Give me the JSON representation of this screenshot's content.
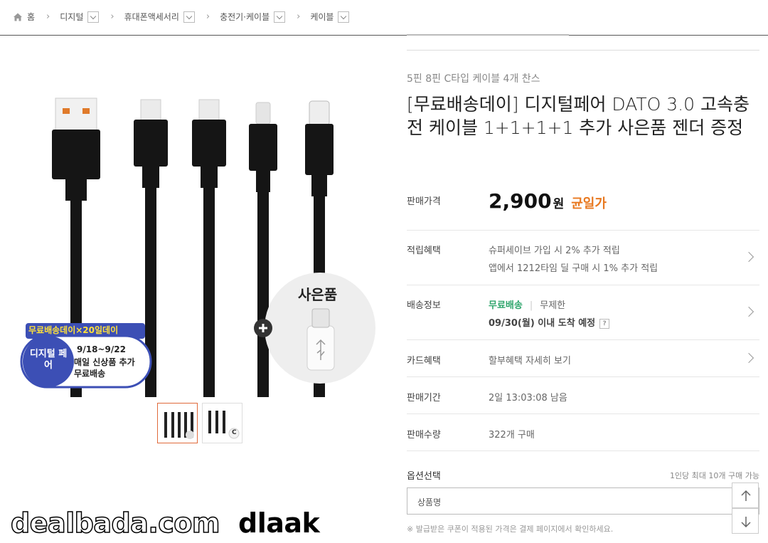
{
  "breadcrumb": {
    "home": "홈",
    "items": [
      "디지털",
      "휴대폰액세서리",
      "충전기·케이블",
      "케이블"
    ]
  },
  "product": {
    "subtitle": "5핀 8핀 C타입 케이블 4개 찬스",
    "title": "[무료배송데이] 디지털페어 DATO 3.0 고속충전 케이블 1+1+1+1 추가 사은품 젠더 증정",
    "price_label": "판매가격",
    "price": "2,900",
    "price_unit": "원",
    "price_tag": "균일가",
    "points_label": "적립혜택",
    "points_line1": "슈퍼세이브 가입 시 2% 추가 적립",
    "points_line2": "앱에서 1212타임 딜 구매 시 1% 추가 적립",
    "shipping_label": "배송정보",
    "shipping_free": "무료배송",
    "shipping_unlimited": "무제한",
    "shipping_arrival": "09/30(월) 이내 도착 예정",
    "shipping_help": "?",
    "card_label": "카드혜택",
    "card_value": "할부혜택 자세히 보기",
    "period_label": "판매기간",
    "period_value": "2일 13:03:08 남음",
    "qty_label": "판매수량",
    "qty_value": "322개 구매",
    "option_label": "옵션선택",
    "option_limit": "1인당 최대 10개 구매 가능",
    "option_placeholder": "상품명",
    "notice": "※ 발급받은 쿠폰이 적용된 가격은 결제 페이지에서 확인하세요."
  },
  "image": {
    "gift": "사은품",
    "banner_top": "무료배송데이×20일데이",
    "banner_circle": "디지털 페어",
    "banner_date": "9/18~9/22",
    "banner_line2": "매일 신상품 추가",
    "banner_line3": "무료배송",
    "thumb2_badge": "C"
  },
  "watermark": {
    "site": "dealbada.com",
    "user": "dlaak"
  },
  "colors": {
    "accent_orange": "#e8781f",
    "free_ship_green": "#2ea56b",
    "banner_blue": "#3c4fb5",
    "banner_yellow": "#ffe13a"
  }
}
